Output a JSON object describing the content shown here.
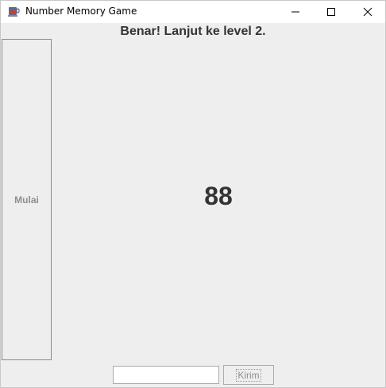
{
  "window": {
    "title": "Number Memory Game",
    "app_icon": "java-cup-icon"
  },
  "titlebar_buttons": {
    "minimize_icon": "minimize-icon",
    "maximize_icon": "maximize-icon",
    "close_icon": "close-icon"
  },
  "game": {
    "status_message": "Benar! Lanjut ke level 2.",
    "start_label": "Mulai",
    "displayed_number": "88",
    "answer_value": "",
    "submit_label": "Kirim"
  },
  "colors": {
    "background": "#eeeeee",
    "text": "#333333",
    "disabled_text": "#8e8e8e"
  }
}
